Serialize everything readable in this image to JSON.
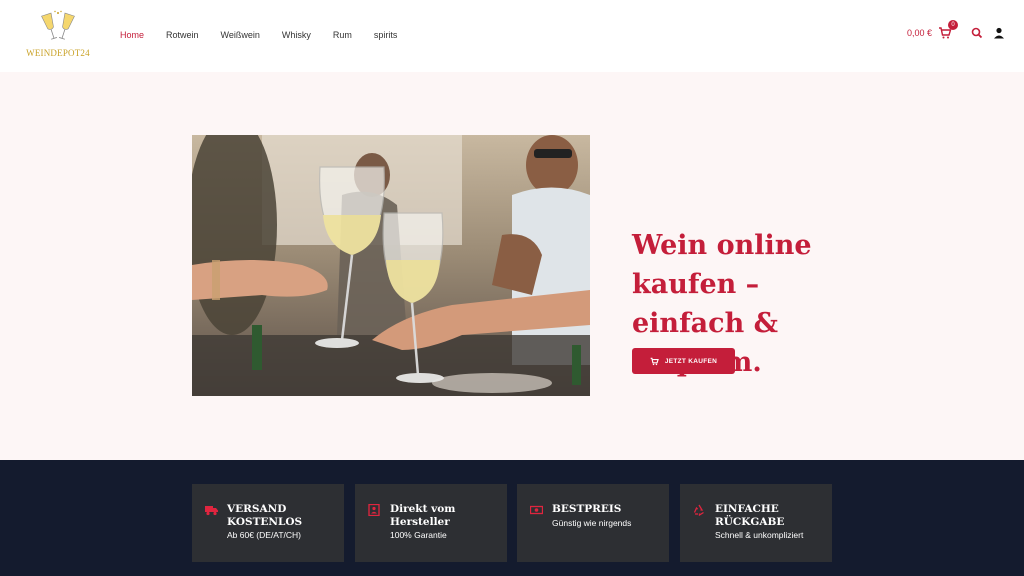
{
  "brand": {
    "logo_text": "WEINDEPOT24"
  },
  "nav": {
    "items": [
      {
        "label": "Home",
        "active": true
      },
      {
        "label": "Rotwein",
        "active": false
      },
      {
        "label": "Weißwein",
        "active": false
      },
      {
        "label": "Whisky",
        "active": false
      },
      {
        "label": "Rum",
        "active": false
      },
      {
        "label": "spirits",
        "active": false
      }
    ]
  },
  "header": {
    "cart_total": "0,00 €",
    "cart_count": "0",
    "icons": [
      "cart-icon",
      "search-icon",
      "user-icon"
    ]
  },
  "hero": {
    "title": "Wein online kaufen – einfach & bequem.",
    "cta_label": "JETZT KAUFEN",
    "image": "people-toasting-white-wine"
  },
  "features": [
    {
      "title": "VERSAND KOSTENLOS",
      "subtitle": "Ab 60€ (DE/AT/CH)",
      "icon": "truck-icon"
    },
    {
      "title": "Direkt vom Hersteller",
      "subtitle": "100% Garantie",
      "icon": "badge-icon"
    },
    {
      "title": "BESTPREIS",
      "subtitle": "Günstig wie nirgends",
      "icon": "money-icon"
    },
    {
      "title": "EINFACHE RÜCKGABE",
      "subtitle": "Schnell & unkompliziert",
      "icon": "recycle-icon"
    }
  ],
  "colors": {
    "accent": "#c41e3a",
    "hero_bg": "#fdf6f6",
    "footer_bg": "#141b2e",
    "card_bg": "#2d2f33",
    "gold": "#c9a227"
  }
}
